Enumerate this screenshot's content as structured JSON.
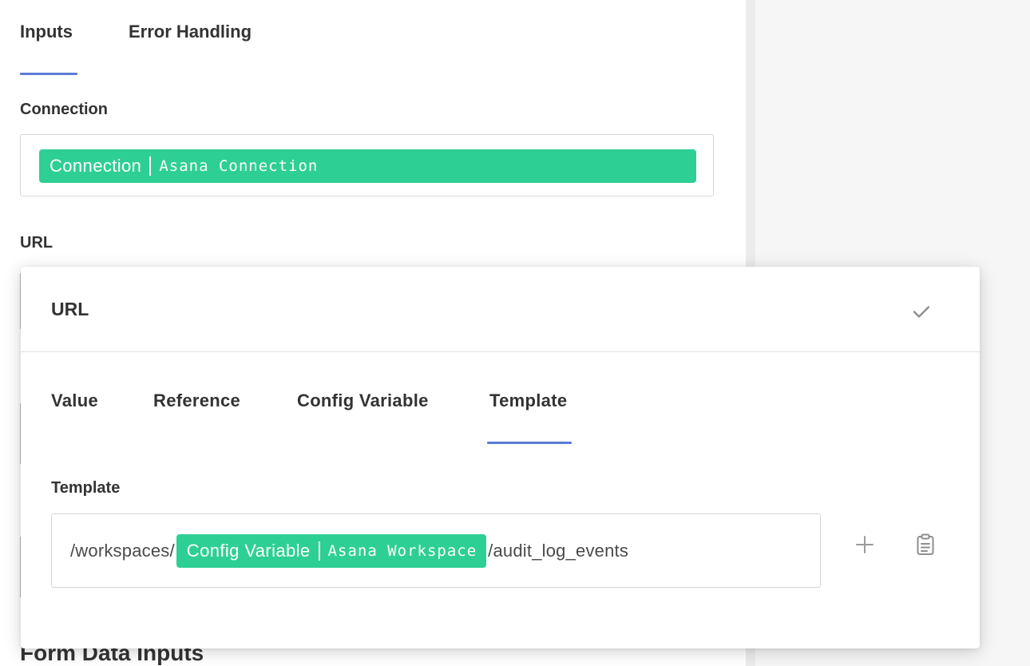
{
  "tabs": [
    {
      "label": "Inputs",
      "active": true
    },
    {
      "label": "Error Handling",
      "active": false
    }
  ],
  "connection": {
    "label": "Connection",
    "chip": {
      "type": "Connection",
      "value": "Asana Connection"
    }
  },
  "url": {
    "label": "URL"
  },
  "bottom_section": {
    "heading": "Form Data Inputs"
  },
  "modal": {
    "title": "URL",
    "confirm_icon": "check-icon",
    "mode_tabs": [
      {
        "label": "Value",
        "active": false
      },
      {
        "label": "Reference",
        "active": false
      },
      {
        "label": "Config Variable",
        "active": false
      },
      {
        "label": "Template",
        "active": true
      }
    ],
    "template": {
      "label": "Template",
      "prefix": "/workspaces/",
      "chip": {
        "type": "Config Variable",
        "value": "Asana Workspace"
      },
      "suffix": "/audit_log_events"
    },
    "actions": [
      {
        "icon": "plus-icon"
      },
      {
        "icon": "clipboard-icon"
      }
    ]
  },
  "colors": {
    "accent": "#5b7bd5",
    "chip": "#2ecf94",
    "panel_gray": "#f6f6f6"
  }
}
